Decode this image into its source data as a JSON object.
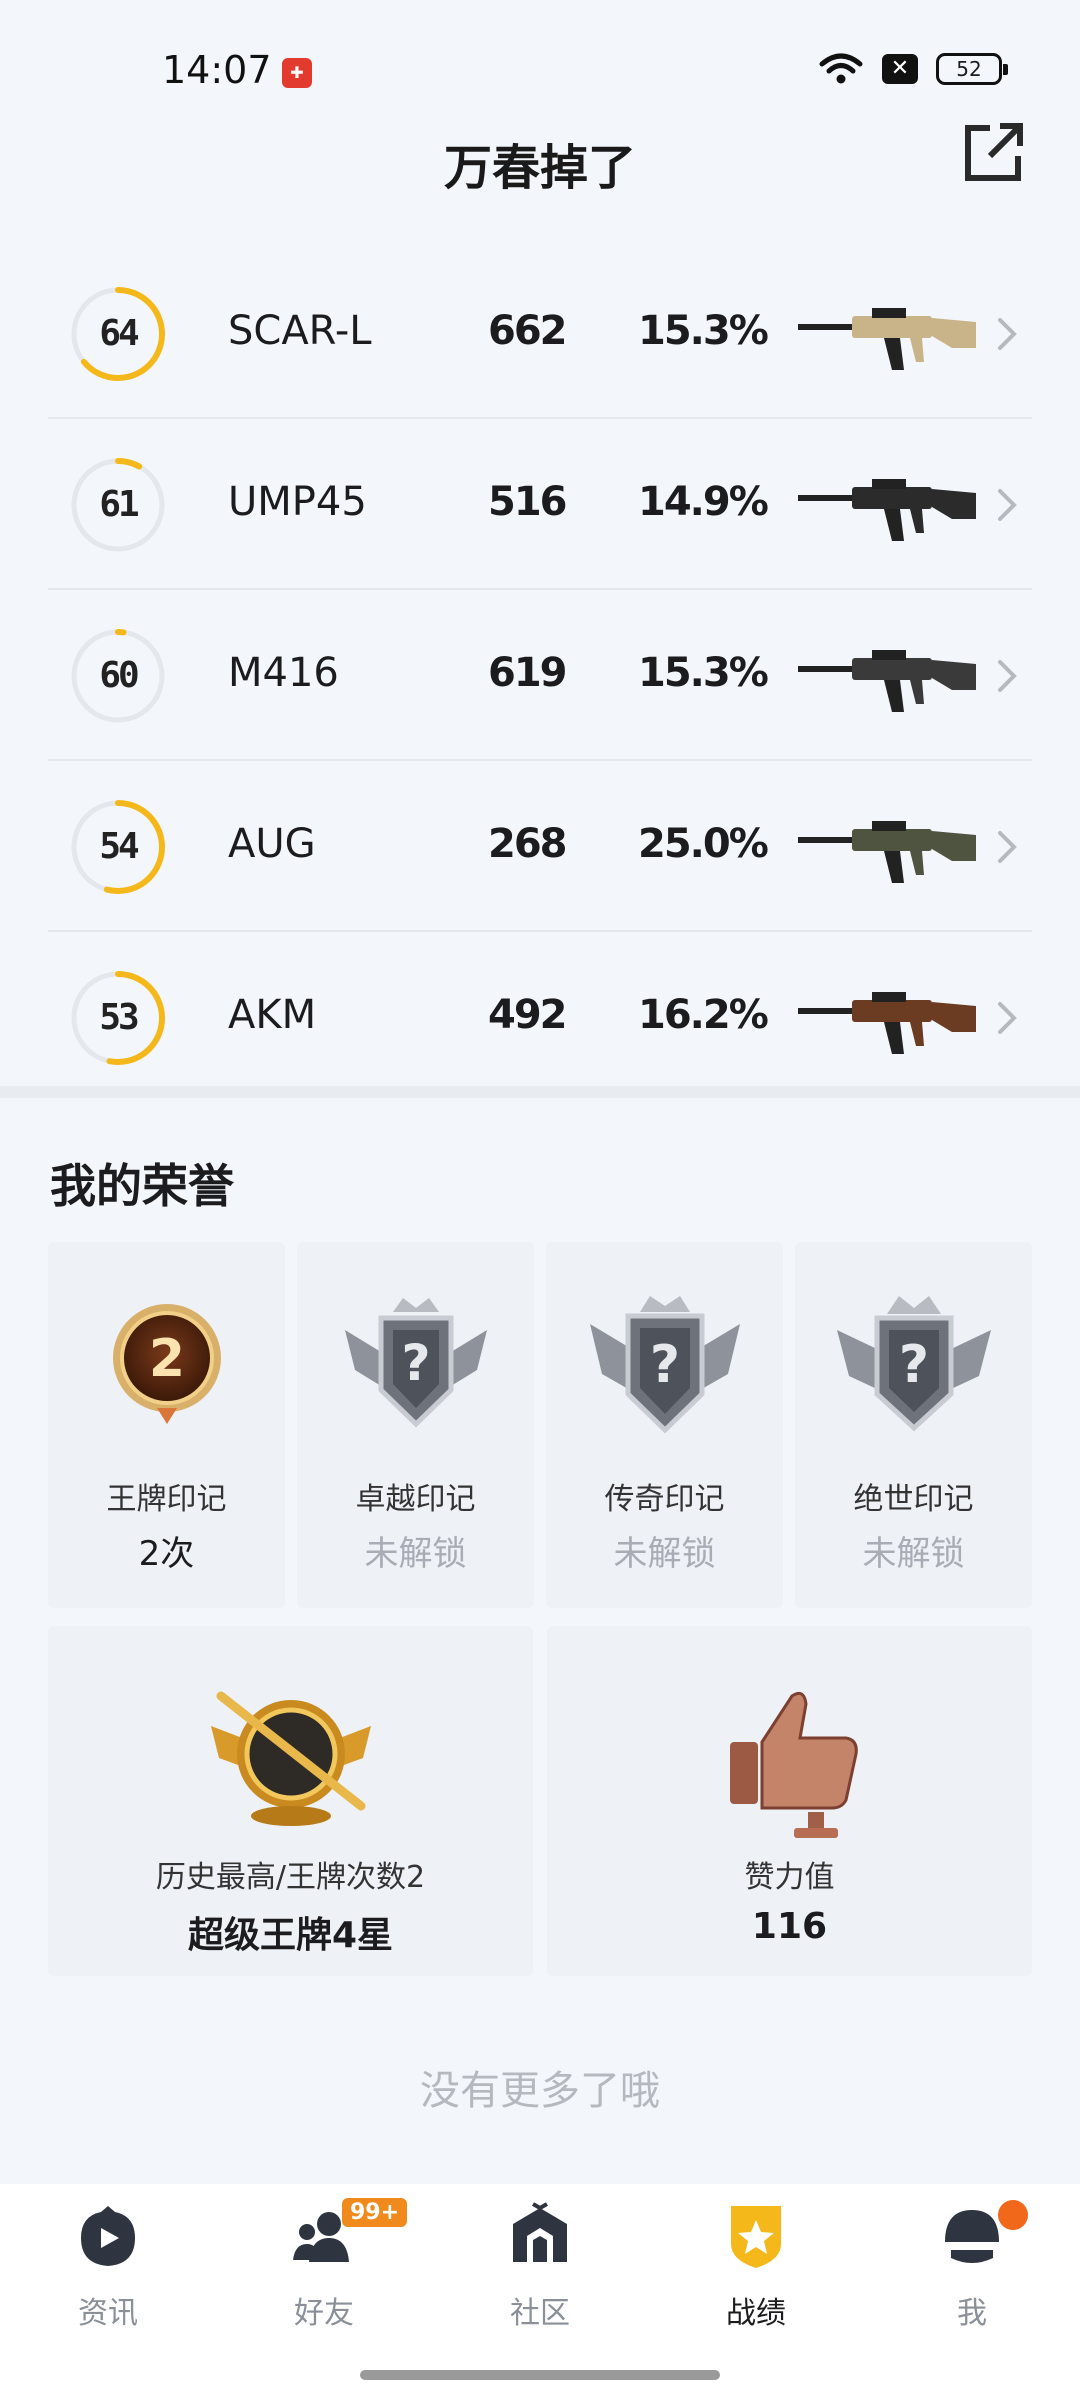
{
  "status_bar": {
    "time": "14:07",
    "app_icon": "app-notification-icon",
    "battery": "52"
  },
  "header": {
    "title": "万春掉了",
    "share_icon": "share-external-icon"
  },
  "weapons": [
    {
      "score": "64",
      "score_fraction": 0.64,
      "name": "SCAR-L",
      "count": "662",
      "percent": "15.3%",
      "color": "#c9b48a"
    },
    {
      "score": "61",
      "score_fraction": 0.08,
      "name": "UMP45",
      "count": "516",
      "percent": "14.9%",
      "color": "#2b2b2b"
    },
    {
      "score": "60",
      "score_fraction": 0.02,
      "name": "M416",
      "count": "619",
      "percent": "15.3%",
      "color": "#3a3a3a"
    },
    {
      "score": "54",
      "score_fraction": 0.54,
      "name": "AUG",
      "count": "268",
      "percent": "25.0%",
      "color": "#4e5440"
    },
    {
      "score": "53",
      "score_fraction": 0.53,
      "name": "AKM",
      "count": "492",
      "percent": "16.2%",
      "color": "#6b3b22"
    }
  ],
  "honor": {
    "title": "我的荣誉",
    "cards": [
      {
        "label": "王牌印记",
        "value": "2次",
        "locked": false,
        "icon": "ace-badge-icon"
      },
      {
        "label": "卓越印记",
        "value": "未解锁",
        "locked": true,
        "icon": "locked-crown-badge-icon"
      },
      {
        "label": "传奇印记",
        "value": "未解锁",
        "locked": true,
        "icon": "locked-crown-badge-icon"
      },
      {
        "label": "绝世印记",
        "value": "未解锁",
        "locked": true,
        "icon": "locked-crown-badge-icon"
      }
    ],
    "wide_cards": [
      {
        "label": "历史最高/王牌次数2",
        "value": "超级王牌4星",
        "icon": "gold-rank-emblem-icon"
      },
      {
        "label": "赞力值",
        "value": "116",
        "icon": "thumbs-up-trophy-icon"
      }
    ],
    "ace_number": "2"
  },
  "footer_text": "没有更多了哦",
  "bottom_nav": {
    "items": [
      {
        "label": "资讯",
        "icon": "news-play-icon",
        "active": false
      },
      {
        "label": "好友",
        "icon": "friends-icon",
        "active": false,
        "badge": "99+"
      },
      {
        "label": "社区",
        "icon": "community-house-icon",
        "active": false
      },
      {
        "label": "战绩",
        "icon": "record-star-shield-icon",
        "active": true
      },
      {
        "label": "我",
        "icon": "helmet-profile-icon",
        "active": false
      }
    ]
  },
  "colors": {
    "accent": "#f5b81b",
    "ring_track": "#e4e7ec",
    "badge": "#f08a1c"
  }
}
